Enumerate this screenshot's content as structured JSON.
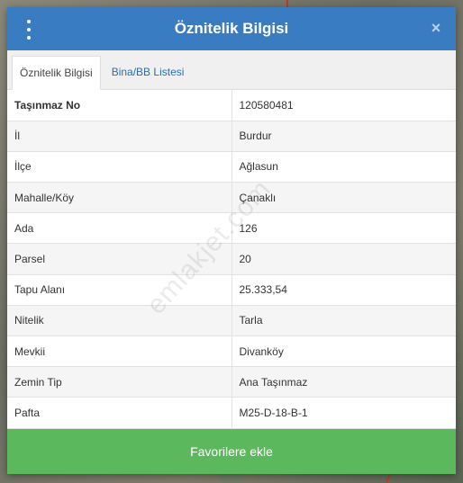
{
  "header": {
    "title": "Öznitelik Bilgisi",
    "close_label": "×"
  },
  "tabs": [
    {
      "label": "Öznitelik Bilgisi",
      "active": true
    },
    {
      "label": "Bina/BB Listesi",
      "active": false
    }
  ],
  "rows": [
    {
      "key": "Taşınmaz No",
      "value": "120580481"
    },
    {
      "key": "İl",
      "value": "Burdur"
    },
    {
      "key": "İlçe",
      "value": "Ağlasun"
    },
    {
      "key": "Mahalle/Köy",
      "value": "Çanaklı"
    },
    {
      "key": "Ada",
      "value": "126"
    },
    {
      "key": "Parsel",
      "value": "20"
    },
    {
      "key": "Tapu Alanı",
      "value": "25.333,54"
    },
    {
      "key": "Nitelik",
      "value": "Tarla"
    },
    {
      "key": "Mevkii",
      "value": "Divanköy"
    },
    {
      "key": "Zemin Tip",
      "value": "Ana Taşınmaz"
    },
    {
      "key": "Pafta",
      "value": "M25-D-18-B-1"
    }
  ],
  "footer": {
    "button_label": "Favorilere ekle"
  },
  "watermark": "emlakjet.com",
  "colors": {
    "header_bg": "#3a7cc1",
    "footer_bg": "#5cb85c",
    "tab_link": "#2a6db3"
  }
}
